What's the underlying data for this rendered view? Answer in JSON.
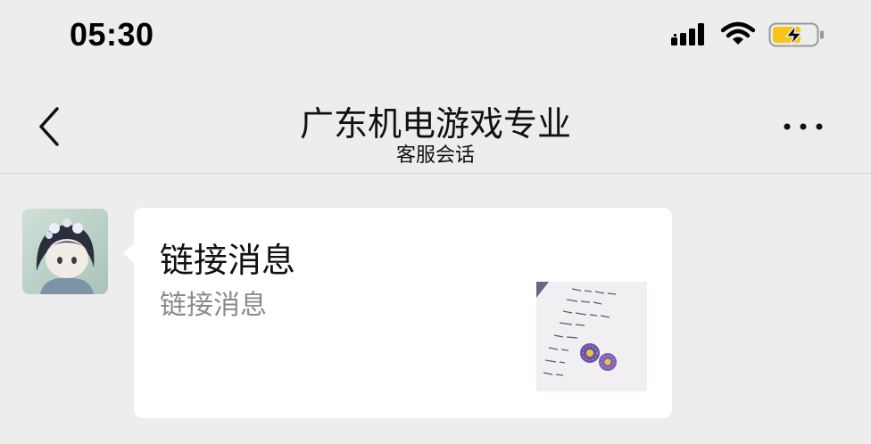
{
  "status_bar": {
    "time": "05:30",
    "icons": [
      "signal-icon",
      "wifi-icon",
      "battery-charging-icon"
    ]
  },
  "nav": {
    "back_icon": "chevron-left-icon",
    "title": "广东机电游戏专业",
    "subtitle": "客服会话",
    "more_icon": "more-dots-icon"
  },
  "messages": [
    {
      "type": "link-card",
      "avatar": "avatar-girl-with-flowers",
      "title": "链接消息",
      "description": "链接消息",
      "thumbnail": "thumbnail-handwritten-note-with-purple-flowers"
    }
  ],
  "colors": {
    "background": "#ededed",
    "card": "#ffffff",
    "description_text": "#8a8a8a",
    "battery_fill": "#f5c518"
  }
}
